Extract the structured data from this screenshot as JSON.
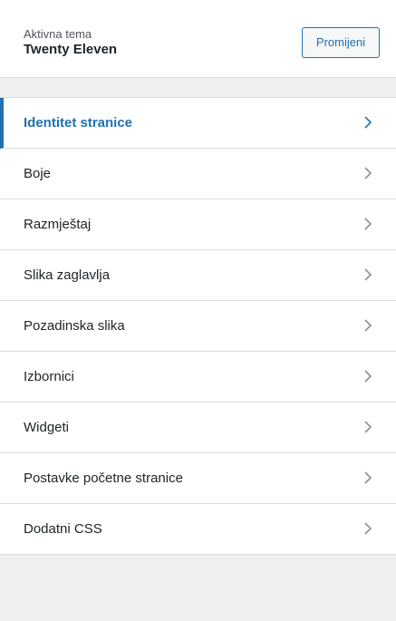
{
  "theme": {
    "caption": "Aktivna tema",
    "name": "Twenty Eleven",
    "change_label": "Promijeni"
  },
  "menu": {
    "items": [
      {
        "label": "Identitet stranice",
        "active": true
      },
      {
        "label": "Boje",
        "active": false
      },
      {
        "label": "Razmještaj",
        "active": false
      },
      {
        "label": "Slika zaglavlja",
        "active": false
      },
      {
        "label": "Pozadinska slika",
        "active": false
      },
      {
        "label": "Izbornici",
        "active": false
      },
      {
        "label": "Widgeti",
        "active": false
      },
      {
        "label": "Postavke početne stranice",
        "active": false
      },
      {
        "label": "Dodatni CSS",
        "active": false
      }
    ]
  },
  "colors": {
    "accent": "#2271b1",
    "chevron": "#8c8f94",
    "background": "#f0f0f1"
  }
}
